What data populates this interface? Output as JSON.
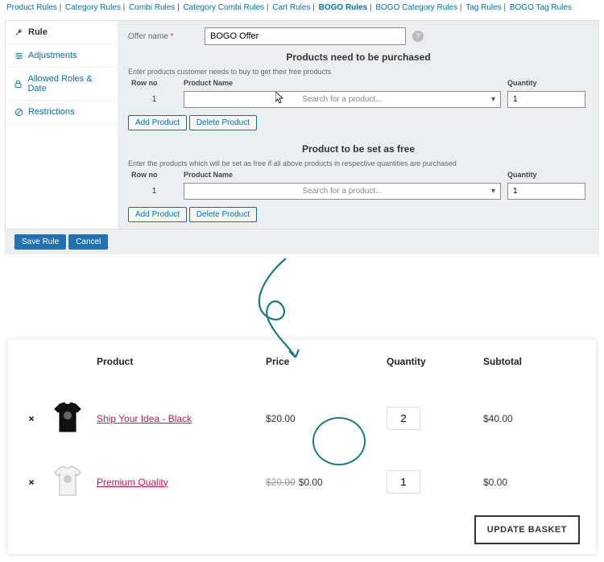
{
  "nav": {
    "items": [
      "Product Rules",
      "Category Rules",
      "Combi Rules",
      "Category Combi Rules",
      "Cart Rules",
      "BOGO Rules",
      "BOGO Category Rules",
      "Tag Rules",
      "BOGO Tag Rules"
    ],
    "active_index": 5
  },
  "sidebar": {
    "items": [
      {
        "icon": "wrench",
        "label": "Rule"
      },
      {
        "icon": "sliders",
        "label": "Adjustments"
      },
      {
        "icon": "lock",
        "label": "Allowed Roles & Date"
      },
      {
        "icon": "ban",
        "label": "Restrictions"
      }
    ],
    "active_index": 0
  },
  "form": {
    "offer_label": "Offer name",
    "offer_required": "*",
    "offer_value": "BOGO Offer",
    "help": "?"
  },
  "purchase_section": {
    "title": "Products need to be purchased",
    "hint": "Enter products customer needs to buy to get their free products",
    "headers": {
      "rowno": "Row no",
      "product": "Product Name",
      "qty": "Quantity"
    },
    "row": {
      "no": "1",
      "placeholder": "Search for a product...",
      "qty": "1"
    },
    "add": "Add Product",
    "del": "Delete Product"
  },
  "free_section": {
    "title": "Product to be set as free",
    "hint": "Enter the products which will be set as free if all above products in respective quantities are purchased",
    "headers": {
      "rowno": "Row no",
      "product": "Product Name",
      "qty": "Quantity"
    },
    "row": {
      "no": "1",
      "placeholder": "Search for a product...",
      "qty": "1"
    },
    "add": "Add Product",
    "del": "Delete Product"
  },
  "footer": {
    "save": "Save Rule",
    "cancel": "Cancel"
  },
  "cart": {
    "headers": {
      "product": "Product",
      "price": "Price",
      "qty": "Quantity",
      "subtotal": "Subtotal"
    },
    "rows": [
      {
        "remove": "×",
        "name": "Ship Your Idea - Black",
        "price": "$20.00",
        "old_price": "",
        "qty": "2",
        "subtotal": "$40.00",
        "shirt": "black"
      },
      {
        "remove": "×",
        "name": "Premium Quality",
        "price": "$0.00",
        "old_price": "$20.00",
        "qty": "1",
        "subtotal": "$0.00",
        "shirt": "white"
      }
    ],
    "update": "UPDATE BASKET"
  }
}
